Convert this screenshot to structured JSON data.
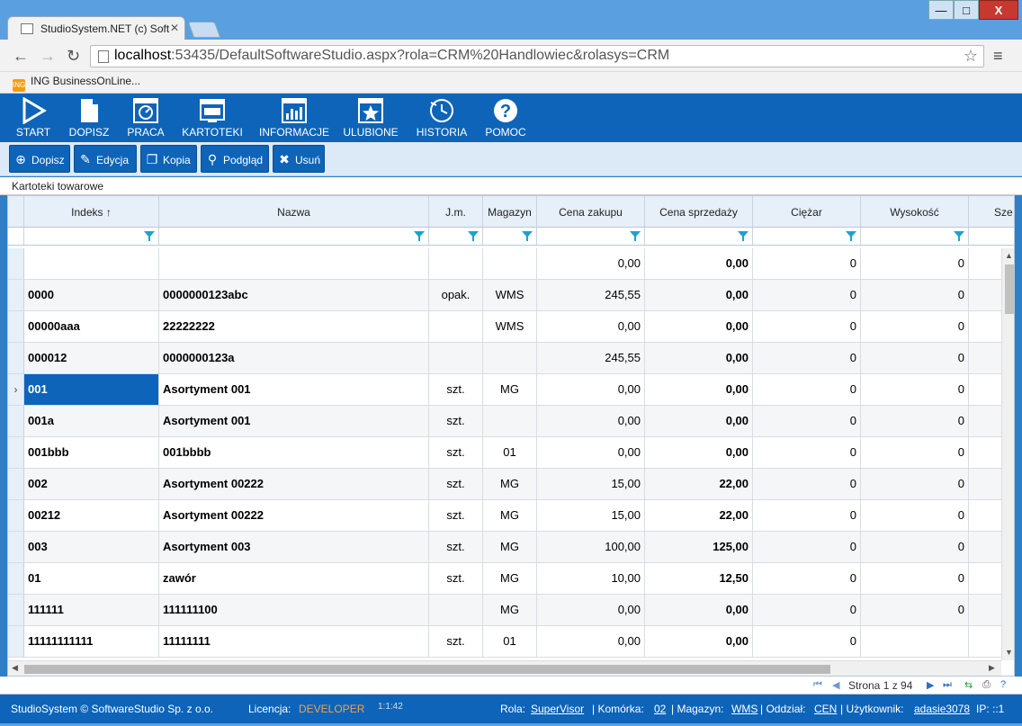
{
  "browser": {
    "tab_title": "StudioSystem.NET (c) Soft",
    "url_host": "localhost",
    "url_path": ":53435/DefaultSoftwareStudio.aspx?rola=CRM%20Handlowiec&rolasys=CRM",
    "bookmark": "ING BusinessOnLine..."
  },
  "window": {
    "min": "—",
    "max": "□",
    "close": "X"
  },
  "appbar": {
    "items": [
      {
        "label": "START",
        "icon": "play-icon"
      },
      {
        "label": "DOPISZ",
        "icon": "new-document-icon"
      },
      {
        "label": "PRACA",
        "icon": "work-icon"
      },
      {
        "label": "KARTOTEKI",
        "icon": "cards-icon"
      },
      {
        "label": "INFORMACJE",
        "icon": "chart-icon"
      },
      {
        "label": "ULUBIONE",
        "icon": "star-icon"
      },
      {
        "label": "HISTORIA",
        "icon": "history-icon"
      },
      {
        "label": "POMOC",
        "icon": "help-icon"
      }
    ]
  },
  "actions": {
    "dopisz": "Dopisz",
    "edycja": "Edycja",
    "kopia": "Kopia",
    "podglad": "Podgląd",
    "usun": "Usuń"
  },
  "section_title": "Kartoteki towarowe",
  "grid": {
    "columns": [
      "Indeks ↑",
      "Nazwa",
      "J.m.",
      "Magazyn",
      "Cena zakupu",
      "Cena sprzedaży",
      "Ciężar",
      "Wysokość",
      "Sze"
    ],
    "rows": [
      {
        "indeks": "",
        "nazwa": "",
        "jm": "",
        "magazyn": "",
        "cena_zakupu": "0,00",
        "cena_sprzedazy": "0,00",
        "ciezar": "0",
        "wysokosc": "0"
      },
      {
        "indeks": "0000",
        "nazwa": "0000000123abc",
        "jm": "opak.",
        "magazyn": "WMS",
        "cena_zakupu": "245,55",
        "cena_sprzedazy": "0,00",
        "ciezar": "0",
        "wysokosc": "0"
      },
      {
        "indeks": "00000aaa",
        "nazwa": "22222222",
        "jm": "",
        "magazyn": "WMS",
        "cena_zakupu": "0,00",
        "cena_sprzedazy": "0,00",
        "ciezar": "0",
        "wysokosc": "0"
      },
      {
        "indeks": "000012",
        "nazwa": "0000000123a",
        "jm": "",
        "magazyn": "",
        "cena_zakupu": "245,55",
        "cena_sprzedazy": "0,00",
        "ciezar": "0",
        "wysokosc": "0"
      },
      {
        "indeks": "001",
        "nazwa": "Asortyment 001",
        "jm": "szt.",
        "magazyn": "MG",
        "cena_zakupu": "0,00",
        "cena_sprzedazy": "0,00",
        "ciezar": "0",
        "wysokosc": "0"
      },
      {
        "indeks": "001a",
        "nazwa": "Asortyment 001",
        "jm": "szt.",
        "magazyn": "",
        "cena_zakupu": "0,00",
        "cena_sprzedazy": "0,00",
        "ciezar": "0",
        "wysokosc": "0"
      },
      {
        "indeks": "001bbb",
        "nazwa": "001bbbb",
        "jm": "szt.",
        "magazyn": "01",
        "cena_zakupu": "0,00",
        "cena_sprzedazy": "0,00",
        "ciezar": "0",
        "wysokosc": "0"
      },
      {
        "indeks": "002",
        "nazwa": "Asortyment 00222",
        "jm": "szt.",
        "magazyn": "MG",
        "cena_zakupu": "15,00",
        "cena_sprzedazy": "22,00",
        "ciezar": "0",
        "wysokosc": "0"
      },
      {
        "indeks": "00212",
        "nazwa": "Asortyment 00222",
        "jm": "szt.",
        "magazyn": "MG",
        "cena_zakupu": "15,00",
        "cena_sprzedazy": "22,00",
        "ciezar": "0",
        "wysokosc": "0"
      },
      {
        "indeks": "003",
        "nazwa": "Asortyment 003",
        "jm": "szt.",
        "magazyn": "MG",
        "cena_zakupu": "100,00",
        "cena_sprzedazy": "125,00",
        "ciezar": "0",
        "wysokosc": "0"
      },
      {
        "indeks": "01",
        "nazwa": "zawór",
        "jm": "szt.",
        "magazyn": "MG",
        "cena_zakupu": "10,00",
        "cena_sprzedazy": "12,50",
        "ciezar": "0",
        "wysokosc": "0"
      },
      {
        "indeks": "111111",
        "nazwa": "111111100",
        "jm": "",
        "magazyn": "MG",
        "cena_zakupu": "0,00",
        "cena_sprzedazy": "0,00",
        "ciezar": "0",
        "wysokosc": "0"
      },
      {
        "indeks": "11111111111",
        "nazwa": "11111111",
        "jm": "szt.",
        "magazyn": "01",
        "cena_zakupu": "0,00",
        "cena_sprzedazy": "0,00",
        "ciezar": "0",
        "wysokosc": ""
      }
    ],
    "selected_row": 4
  },
  "pager": {
    "text": "Strona 1 z 94"
  },
  "status": {
    "brand": "StudioSystem © SoftwareStudio Sp. z o.o.",
    "licencja_label": "Licencja:",
    "licencja_value": "DEVELOPER",
    "time": "1:1:42",
    "rola_label": "Rola:",
    "rola_value": "SuperVisor",
    "komorka_label": "| Komórka:",
    "komorka_value": "02",
    "magazyn_label": "| Magazyn:",
    "magazyn_value": "WMS",
    "oddzial_label": "| Oddział:",
    "oddzial_value": "CEN",
    "uzytkownik_label": "| Użytkownik:",
    "uzytkownik_value": "adasie3078",
    "ip": "IP: ::1"
  }
}
